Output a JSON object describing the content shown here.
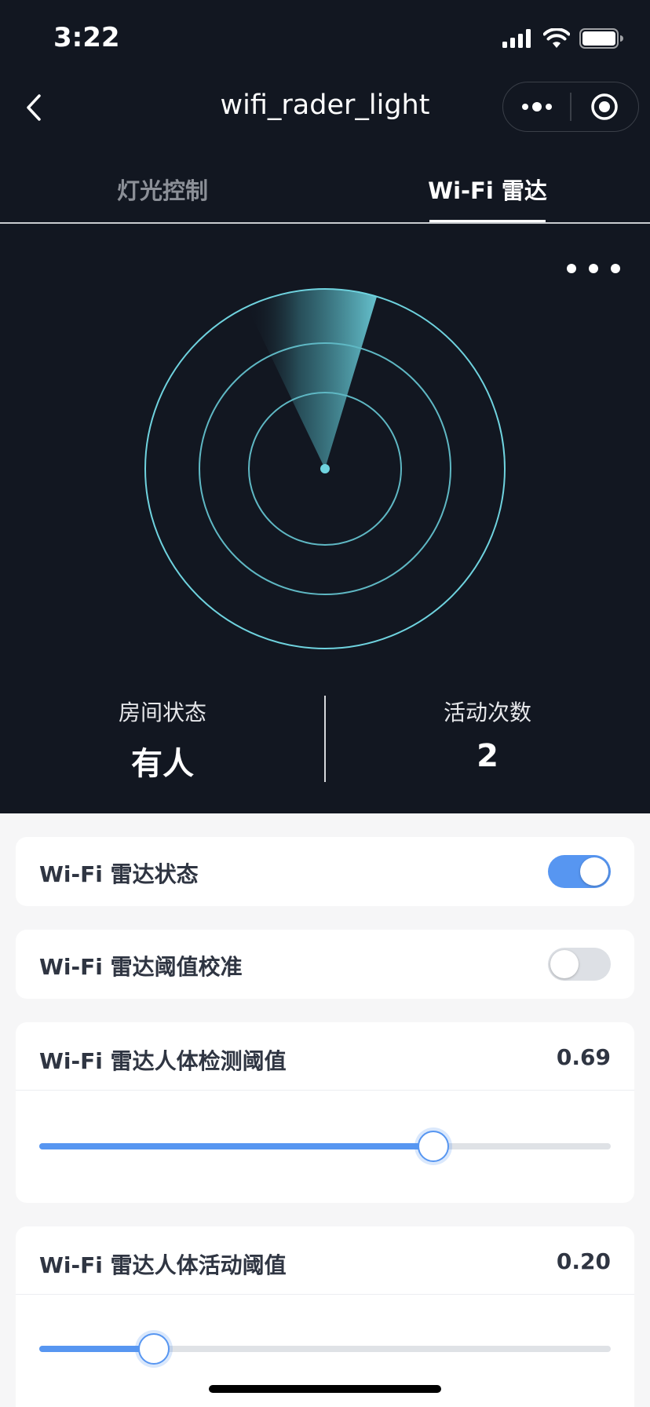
{
  "status_bar": {
    "time": "3:22"
  },
  "nav": {
    "title": "wifi_rader_light"
  },
  "tabs": [
    {
      "label": "灯光控制",
      "active": false
    },
    {
      "label": "Wi-Fi 雷达",
      "active": true
    }
  ],
  "stats": {
    "room_status": {
      "label": "房间状态",
      "value": "有人"
    },
    "activity_count": {
      "label": "活动次数",
      "value": "2"
    }
  },
  "settings": {
    "radar_status": {
      "label": "Wi-Fi 雷达状态",
      "enabled": true
    },
    "threshold_calibration": {
      "label": "Wi-Fi 雷达阈值校准",
      "enabled": false
    },
    "detection_threshold": {
      "label": "Wi-Fi 雷达人体检测阈值",
      "value": "0.69",
      "fraction": 0.69
    },
    "activity_threshold": {
      "label": "Wi-Fi 雷达人体活动阈值",
      "value": "0.20",
      "fraction": 0.2
    }
  },
  "colors": {
    "background_dark": "#121721",
    "radar_cyan": "#6fd3df",
    "accent_blue": "#5796f1",
    "toggle_off": "#dde0e5"
  },
  "icons": [
    "back-arrow-icon",
    "more-dots-icon",
    "record-target-icon",
    "signal-icon",
    "wifi-icon",
    "battery-icon",
    "overflow-dots-icon"
  ]
}
